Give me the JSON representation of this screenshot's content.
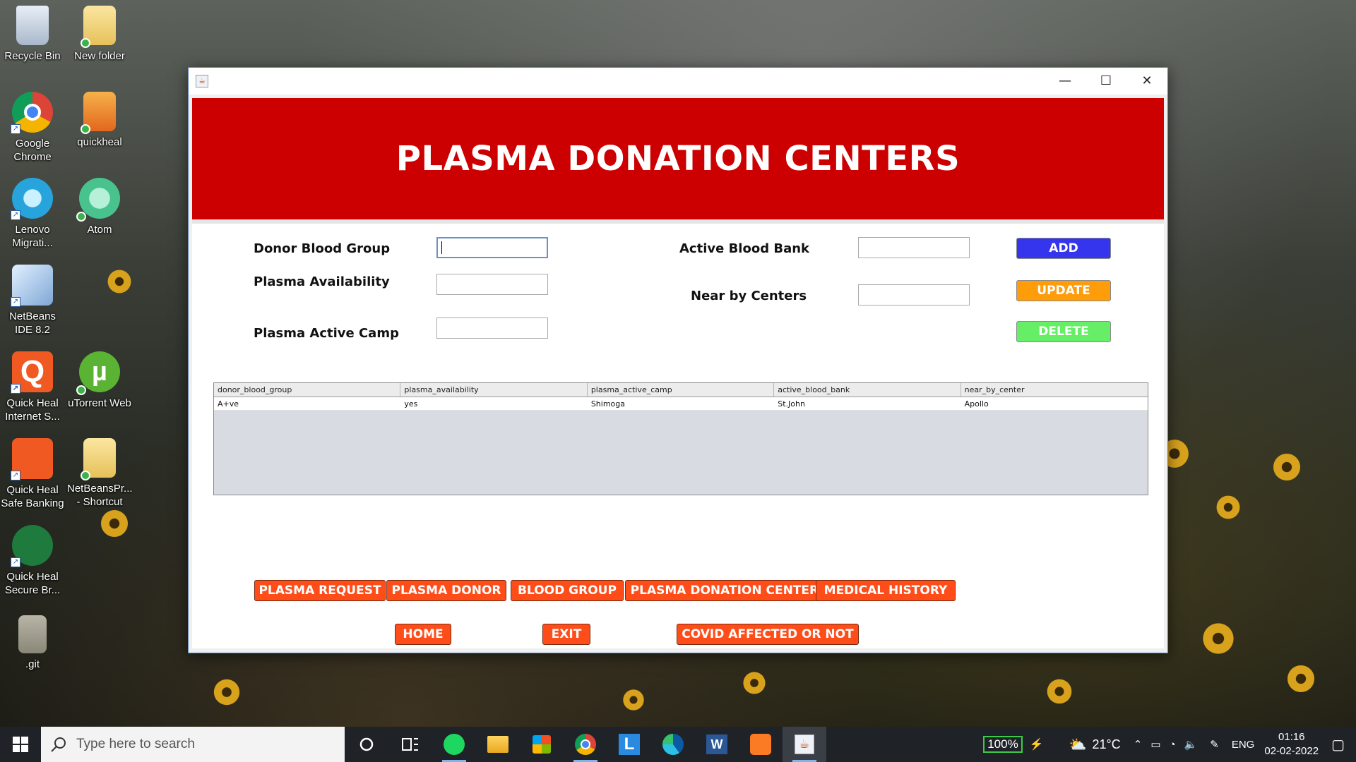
{
  "desktop": {
    "icons": [
      {
        "label": "Recycle Bin"
      },
      {
        "label": "New folder"
      },
      {
        "label": "Google Chrome"
      },
      {
        "label": "quickheal"
      },
      {
        "label": "Lenovo Migrati..."
      },
      {
        "label": "Atom"
      },
      {
        "label": "NetBeans IDE 8.2"
      },
      {
        "label": "Quick Heal Internet S..."
      },
      {
        "label": "uTorrent Web"
      },
      {
        "label": "Quick Heal Safe Banking"
      },
      {
        "label": "NetBeansPr... - Shortcut"
      },
      {
        "label": "Quick Heal Secure Br..."
      },
      {
        "label": ".git"
      }
    ]
  },
  "window": {
    "controls": {
      "minimize": "—",
      "maximize": "☐",
      "close": "✕"
    },
    "banner_title": "PLASMA DONATION CENTERS",
    "form": {
      "donor_blood_group_label": "Donor Blood Group",
      "plasma_availability_label": "Plasma Availability",
      "plasma_active_camp_label": "Plasma Active Camp",
      "active_blood_bank_label": "Active Blood Bank",
      "near_by_centers_label": "Near by Centers",
      "donor_blood_group_value": "",
      "plasma_availability_value": "",
      "plasma_active_camp_value": "",
      "active_blood_bank_value": "",
      "near_by_centers_value": ""
    },
    "actions": {
      "add": "ADD",
      "update": "UPDATE",
      "delete": "DELETE"
    },
    "table": {
      "columns": [
        "donor_blood_group",
        "plasma_availability",
        "plasma_active_camp",
        "active_blood_bank",
        "near_by_center"
      ],
      "rows": [
        [
          "A+ve",
          "yes",
          "Shimoga",
          "St.John",
          "Apollo"
        ]
      ]
    },
    "nav": {
      "plasma_request": "PLASMA REQUEST",
      "plasma_donor": "PLASMA DONOR",
      "blood_group": "BLOOD GROUP",
      "plasma_donation_centers": "PLASMA DONATION CENTERS",
      "medical_history": "MEDICAL HISTORY",
      "home": "HOME",
      "exit": "EXIT",
      "covid_affected": "COVID AFFECTED OR NOT"
    }
  },
  "taskbar": {
    "search_placeholder": "Type here to search",
    "battery": "100%",
    "temperature": "21°C",
    "language": "ENG",
    "time": "01:16",
    "date": "02-02-2022"
  },
  "colors": {
    "banner": "#cc0000",
    "add_button": "#3535ee",
    "update_button": "#ff9c0a",
    "delete_button": "#66ee66",
    "nav_button": "#ff4d1a"
  }
}
